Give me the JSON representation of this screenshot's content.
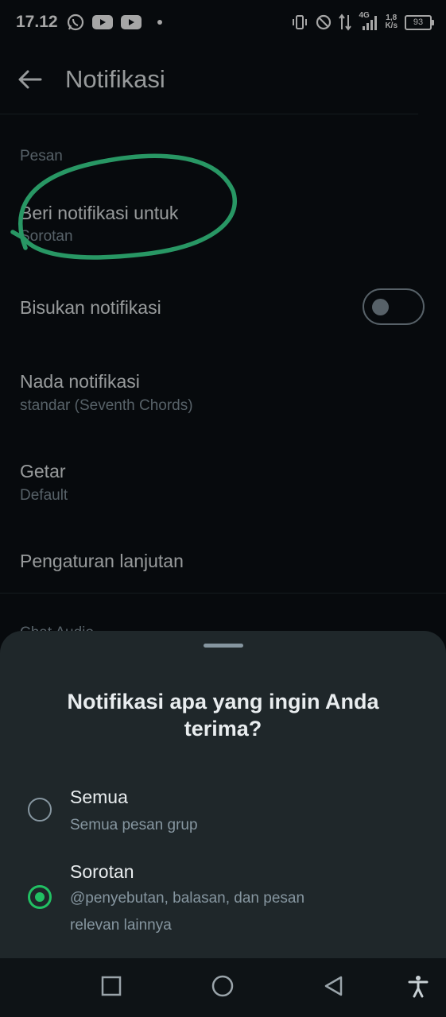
{
  "status_bar": {
    "time": "17.12",
    "network": "4G",
    "speed_value": "1,8",
    "speed_unit": "K/s",
    "battery": "93"
  },
  "app_bar": {
    "title": "Notifikasi",
    "back_icon": "arrow-left-icon"
  },
  "settings": {
    "section_label": "Pesan",
    "items": [
      {
        "title": "Beri notifikasi untuk",
        "subtitle": "Sorotan"
      },
      {
        "title": "Bisukan notifikasi",
        "toggle": false
      },
      {
        "title": "Nada notifikasi",
        "subtitle": "standar (Seventh Chords)"
      },
      {
        "title": "Getar",
        "subtitle": "Default"
      },
      {
        "title": "Pengaturan lanjutan"
      }
    ],
    "next_section_partial": "Chat Audio"
  },
  "annotation": {
    "color": "#3ee89a"
  },
  "sheet": {
    "title": "Notifikasi apa yang ingin Anda terima?",
    "options": [
      {
        "title": "Semua",
        "subtitle": "Semua pesan grup",
        "selected": false
      },
      {
        "title": "Sorotan",
        "subtitle": "@penyebutan, balasan, dan pesan relevan lainnya",
        "selected": true
      }
    ],
    "accent": "#21c063"
  },
  "nav_bar": {
    "buttons": [
      "recents-square-icon",
      "home-circle-icon",
      "back-triangle-icon",
      "accessibility-icon"
    ]
  }
}
